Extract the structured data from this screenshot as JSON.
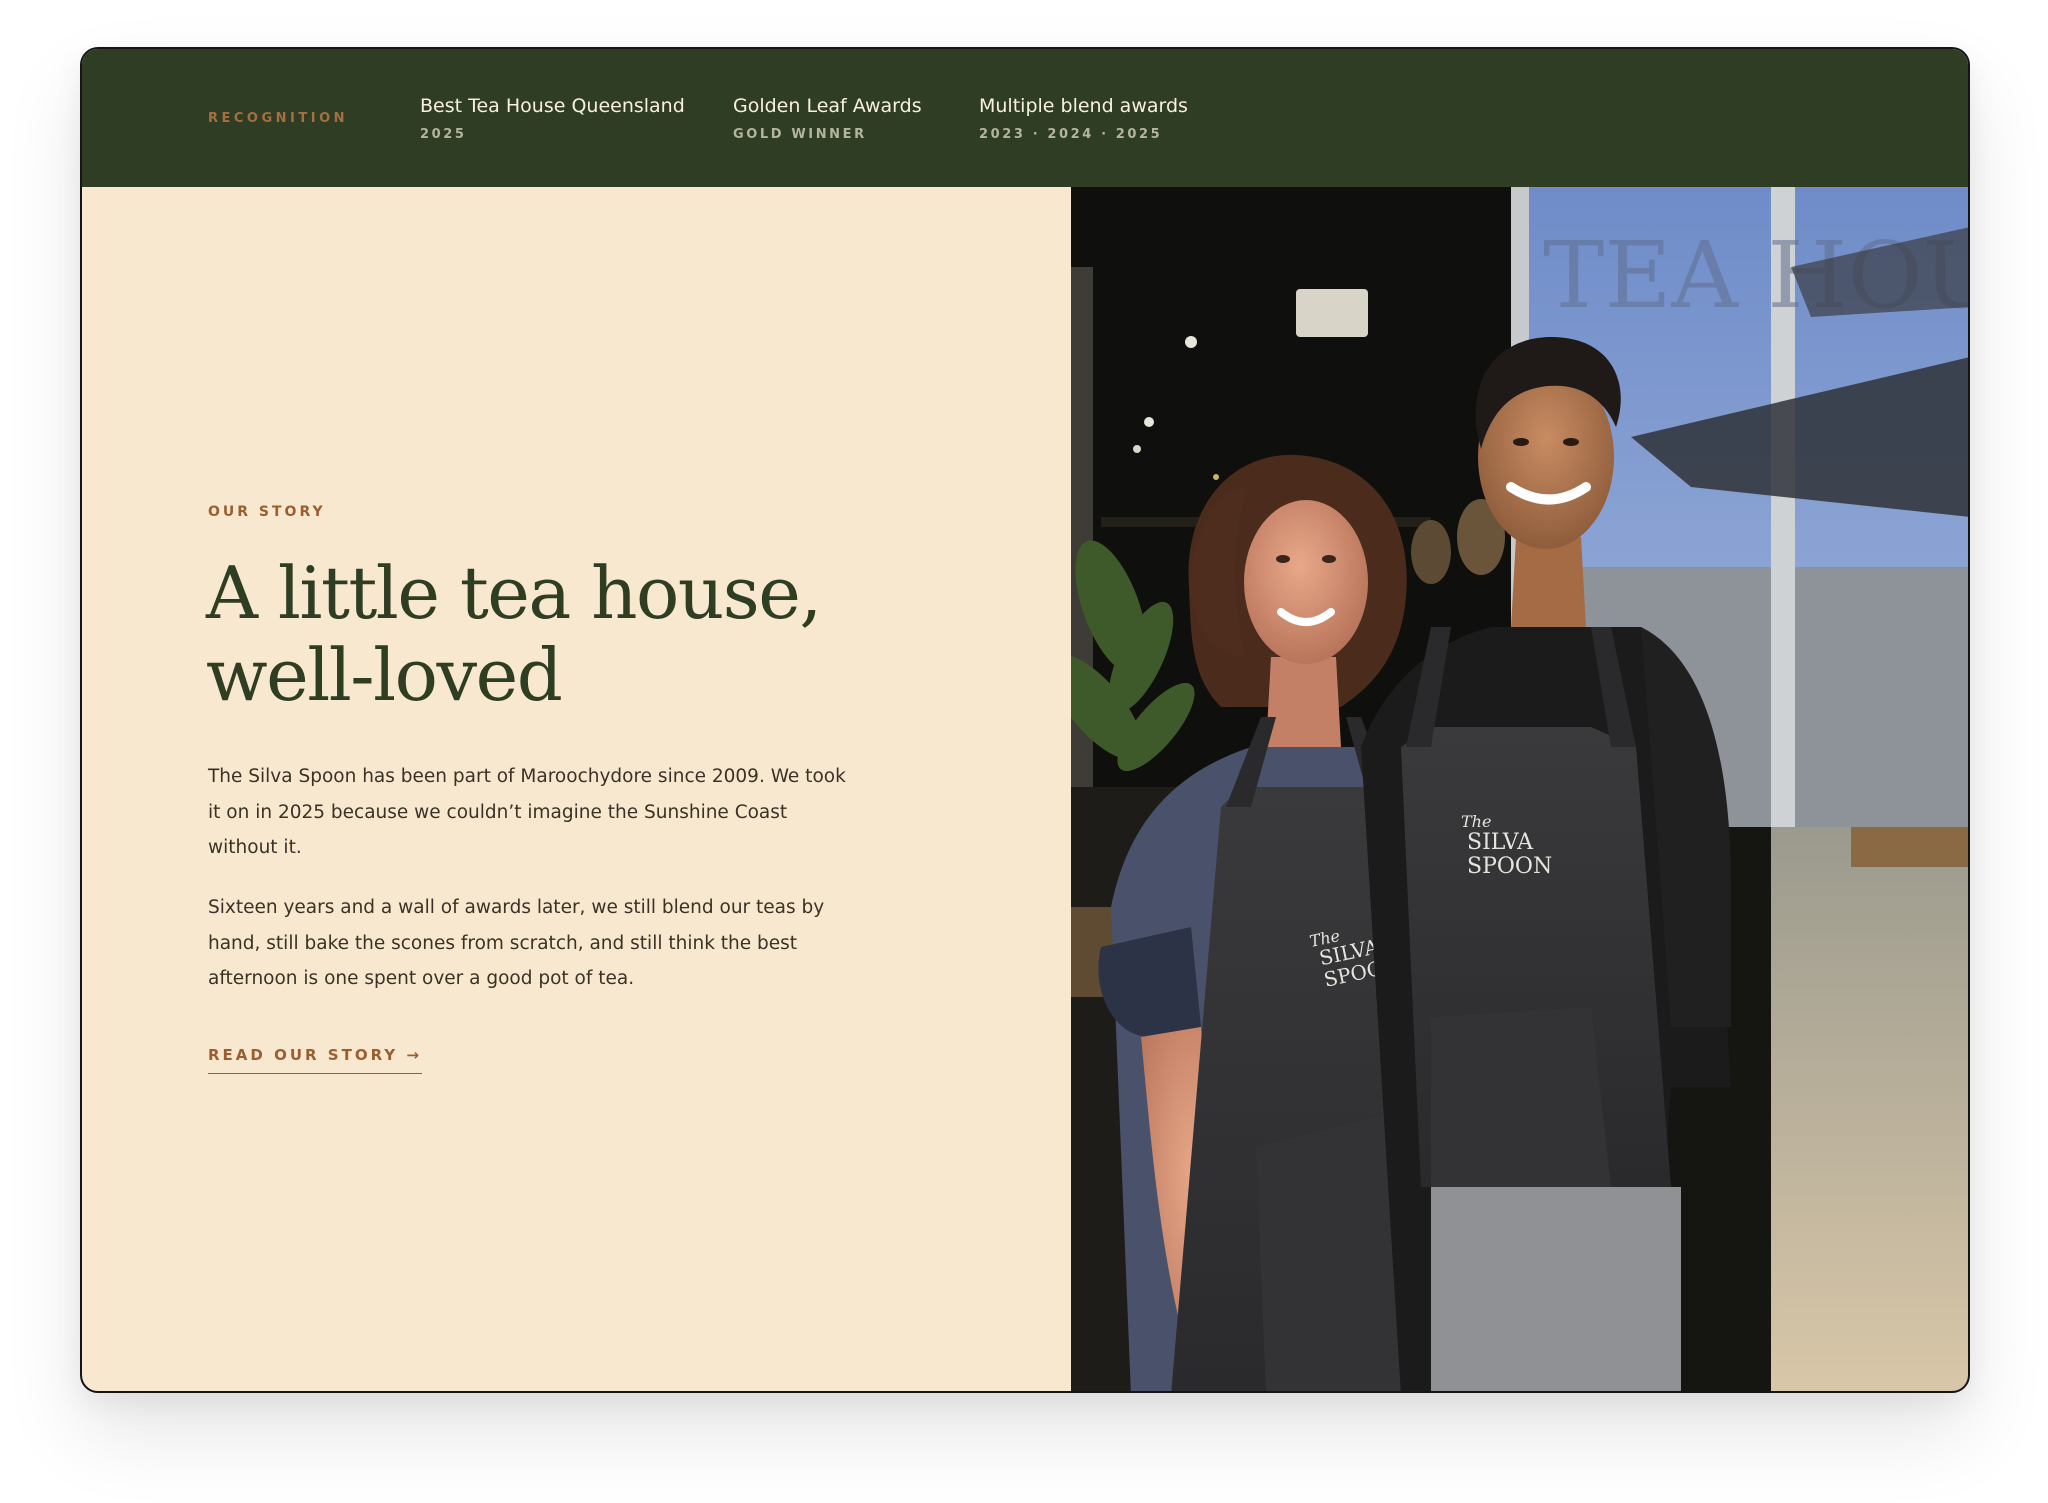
{
  "recognition": {
    "label": "RECOGNITION",
    "awards": [
      {
        "title": "Best Tea House Queensland",
        "subtitle": "2025"
      },
      {
        "title": "Golden Leaf Awards",
        "subtitle": "GOLD WINNER"
      },
      {
        "title": "Multiple blend awards",
        "subtitle": "2023 · 2024 · 2025"
      }
    ]
  },
  "story": {
    "eyebrow": "OUR STORY",
    "headline_line1": "A little tea house,",
    "headline_line2": "well-loved",
    "paragraphs": [
      "The Silva Spoon has been part of Maroochydore since 2009. We took it on in 2025 because we couldn’t imagine the Sunshine Coast without it.",
      "Sixteen years and a wall of awards later, we still blend our teas by hand, still bake the scones from scratch, and still think the best afternoon is one spent over a good pot of tea."
    ],
    "cta_label": "READ OUR STORY →"
  },
  "photo": {
    "window_lettering": "TEA HOUSE",
    "apron_logo_line1": "The",
    "apron_logo_line2": "SILVA",
    "apron_logo_line3": "SPOON"
  },
  "colors": {
    "forest": "#303d25",
    "cream": "#f8e8cf",
    "copper": "#9b5e2f",
    "headline": "#2f3d22"
  }
}
